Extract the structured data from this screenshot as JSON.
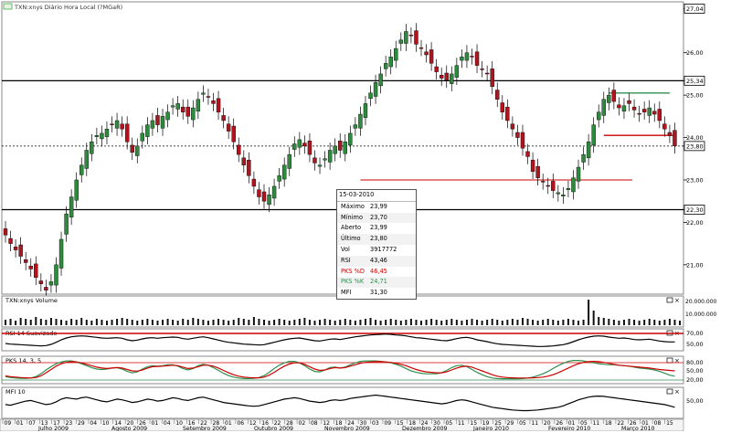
{
  "header": {
    "title": "TXN:xnys Diário Hora Local (?MGaR)"
  },
  "main_chart": {
    "price_labels": [
      "27,04",
      "26,00",
      "25,34",
      "25,00",
      "24,00",
      "23,80",
      "23,00",
      "22,30",
      "22,00",
      "21,00"
    ],
    "ylim": [
      20.35,
      27.2
    ]
  },
  "tooltip": {
    "date": "15-03-2010",
    "rows": [
      {
        "label": "Máximo",
        "value": "23,99",
        "color": "#000000"
      },
      {
        "label": "Mínimo",
        "value": "23,70",
        "color": "#000000"
      },
      {
        "label": "Aberto",
        "value": "23,99",
        "color": "#000000"
      },
      {
        "label": "Último",
        "value": "23,80",
        "color": "#000000"
      },
      {
        "label": "Vol",
        "value": "3917772",
        "color": "#000000"
      },
      {
        "label": "RSI",
        "value": "43,46",
        "color": "#000000"
      },
      {
        "label": "PKS %D",
        "value": "46,45",
        "color": "#cc0000"
      },
      {
        "label": "PKS %K",
        "value": "24,71",
        "color": "#2f8f4f"
      },
      {
        "label": "MFI",
        "value": "31,30",
        "color": "#000000"
      }
    ]
  },
  "panels": {
    "volume": {
      "title": "TXN:xnys Volume",
      "labels": [
        "20.000.000",
        "10.000.000"
      ]
    },
    "rsi": {
      "title": "RSI 14 Suavizado",
      "labels": [
        "70,00",
        "50,00"
      ]
    },
    "pks": {
      "title": "PKS 14, 3, 5",
      "labels": [
        "80,00",
        "50,00",
        "20,00"
      ]
    },
    "mfi": {
      "title": "MFI 10",
      "labels": [
        "50,00"
      ]
    }
  },
  "time_axis": {
    "day_ticks": [
      "09",
      "01",
      "07",
      "13",
      "17",
      "23",
      "29",
      "04",
      "10",
      "14",
      "20",
      "26",
      "01",
      "04",
      "10",
      "16",
      "22",
      "28",
      "01",
      "06",
      "12",
      "16",
      "22",
      "28",
      "02",
      "08",
      "12",
      "18",
      "24",
      "30",
      "03",
      "09",
      "15",
      "18",
      "24",
      "30",
      "05",
      "11",
      "15",
      "19",
      "25",
      "29",
      "05",
      "11",
      "20",
      "26",
      "01",
      "05",
      "11",
      "18",
      "22",
      "26",
      "01",
      "08",
      "15"
    ],
    "month_labels": [
      "Julho 2009",
      "Agosto 2009",
      "Setembro 2009",
      "Outubro 2009",
      "Novembro 2009",
      "Dezembro 2009",
      "Janeiro 2010",
      "Fevereiro 2010",
      "Março 2010"
    ]
  },
  "colors": {
    "up": "#2e8b3e",
    "down": "#b0141e",
    "line_red": "#cc0000",
    "line_green": "#2f8f4f"
  },
  "chart_data": {
    "type": "candlestick",
    "x_start": "2009-06-29",
    "close": [
      21.7,
      21.5,
      21.35,
      21.2,
      21.05,
      20.9,
      20.7,
      20.55,
      20.4,
      20.6,
      21.0,
      21.6,
      22.2,
      22.6,
      23.0,
      23.35,
      23.7,
      23.9,
      24.05,
      24.1,
      24.2,
      24.3,
      24.4,
      24.2,
      23.9,
      23.65,
      23.8,
      24.1,
      24.3,
      24.4,
      24.3,
      24.5,
      24.6,
      24.75,
      24.8,
      24.6,
      24.5,
      24.7,
      24.9,
      25.05,
      24.95,
      24.8,
      24.6,
      24.4,
      24.15,
      23.9,
      23.6,
      23.35,
      23.1,
      22.85,
      22.6,
      22.5,
      22.65,
      22.85,
      23.1,
      23.35,
      23.6,
      23.85,
      23.95,
      23.8,
      23.6,
      23.4,
      23.35,
      23.5,
      23.7,
      23.8,
      23.7,
      23.9,
      24.1,
      24.3,
      24.55,
      24.8,
      25.05,
      25.3,
      25.5,
      25.75,
      25.9,
      26.1,
      26.3,
      26.5,
      26.4,
      26.2,
      26.1,
      25.95,
      25.75,
      25.55,
      25.4,
      25.35,
      25.5,
      25.7,
      25.9,
      26.0,
      25.9,
      25.7,
      25.6,
      25.5,
      25.2,
      24.9,
      24.6,
      24.4,
      24.2,
      24.0,
      23.75,
      23.55,
      23.2,
      23.05,
      22.95,
      22.85,
      22.75,
      22.7,
      22.65,
      22.8,
      23.05,
      23.3,
      23.6,
      23.9,
      24.3,
      24.6,
      24.9,
      25.0,
      24.85,
      24.7,
      24.75,
      24.8,
      24.65,
      24.55,
      24.6,
      24.7,
      24.55,
      24.4,
      24.2,
      24.05,
      23.8
    ],
    "ylim": [
      20.35,
      27.2
    ],
    "horizontal_levels": [
      25.34,
      23.8,
      22.3
    ],
    "volume": [
      6,
      7,
      5,
      8,
      7,
      6,
      9,
      7,
      6,
      8,
      7,
      6,
      5,
      7,
      6,
      8,
      6,
      5,
      7,
      6,
      5,
      6,
      7,
      8,
      7,
      6,
      5,
      6,
      7,
      6,
      5,
      6,
      7,
      6,
      5,
      7,
      6,
      8,
      7,
      6,
      5,
      6,
      7,
      6,
      5,
      6,
      8,
      7,
      6,
      9,
      7,
      6,
      5,
      6,
      7,
      6,
      5,
      6,
      7,
      8,
      6,
      5,
      6,
      7,
      6,
      5,
      6,
      7,
      6,
      5,
      6,
      7,
      8,
      6,
      5,
      6,
      7,
      6,
      5,
      6,
      7,
      6,
      5,
      6,
      7,
      6,
      5,
      6,
      7,
      6,
      5,
      6,
      7,
      6,
      5,
      6,
      7,
      6,
      5,
      6,
      7,
      6,
      8,
      7,
      6,
      5,
      6,
      7,
      6,
      5,
      6,
      7,
      6,
      5,
      6,
      28,
      16,
      9,
      8,
      7,
      6,
      5,
      6,
      7,
      6,
      5,
      6,
      7,
      6,
      5,
      6,
      7,
      6,
      5
    ],
    "rsi": [
      38,
      36,
      35,
      34,
      33,
      32,
      31,
      30,
      31,
      35,
      42,
      50,
      56,
      60,
      62,
      63,
      62,
      60,
      58,
      56,
      55,
      56,
      57,
      55,
      50,
      47,
      49,
      53,
      56,
      57,
      55,
      57,
      58,
      59,
      58,
      54,
      52,
      55,
      58,
      60,
      57,
      53,
      49,
      45,
      42,
      40,
      38,
      36,
      35,
      34,
      33,
      34,
      38,
      42,
      46,
      50,
      53,
      55,
      56,
      53,
      50,
      47,
      46,
      49,
      52,
      53,
      51,
      54,
      57,
      60,
      62,
      64,
      66,
      67,
      68,
      69,
      68,
      66,
      65,
      63,
      60,
      57,
      56,
      54,
      52,
      50,
      48,
      47,
      50,
      54,
      57,
      58,
      55,
      50,
      47,
      44,
      40,
      37,
      35,
      34,
      33,
      32,
      31,
      30,
      29,
      28,
      28,
      29,
      30,
      32,
      34,
      38,
      44,
      50,
      55,
      59,
      62,
      63,
      62,
      59,
      57,
      55,
      56,
      54,
      51,
      50,
      51,
      52,
      49,
      46,
      44,
      43,
      43
    ],
    "pks_d": [
      25,
      22,
      20,
      18,
      17,
      16,
      18,
      25,
      38,
      52,
      66,
      76,
      82,
      85,
      84,
      80,
      74,
      68,
      62,
      58,
      56,
      58,
      60,
      58,
      52,
      46,
      45,
      50,
      58,
      64,
      65,
      66,
      68,
      70,
      68,
      62,
      56,
      58,
      64,
      70,
      70,
      66,
      58,
      48,
      38,
      30,
      24,
      20,
      18,
      17,
      17,
      20,
      28,
      40,
      54,
      66,
      75,
      80,
      80,
      74,
      64,
      54,
      48,
      50,
      56,
      60,
      58,
      60,
      66,
      72,
      78,
      82,
      84,
      85,
      85,
      84,
      82,
      78,
      74,
      68,
      60,
      52,
      46,
      42,
      40,
      38,
      38,
      42,
      50,
      58,
      64,
      66,
      62,
      54,
      46,
      38,
      30,
      24,
      20,
      18,
      17,
      16,
      16,
      16,
      17,
      18,
      20,
      24,
      30,
      38,
      48,
      58,
      68,
      76,
      82,
      85,
      86,
      85,
      82,
      78,
      74,
      70,
      68,
      66,
      64,
      62,
      60,
      58,
      55,
      52,
      50,
      48,
      46
    ],
    "pks_k": [
      22,
      18,
      16,
      15,
      15,
      16,
      22,
      34,
      50,
      64,
      76,
      84,
      88,
      88,
      84,
      76,
      68,
      60,
      54,
      52,
      54,
      58,
      60,
      54,
      44,
      38,
      42,
      54,
      64,
      68,
      66,
      68,
      72,
      72,
      66,
      56,
      50,
      56,
      68,
      74,
      70,
      60,
      48,
      36,
      26,
      20,
      16,
      14,
      14,
      15,
      18,
      26,
      40,
      56,
      70,
      80,
      86,
      86,
      80,
      68,
      54,
      44,
      42,
      50,
      60,
      62,
      58,
      62,
      72,
      80,
      86,
      88,
      88,
      88,
      86,
      84,
      80,
      74,
      66,
      56,
      46,
      40,
      36,
      34,
      34,
      34,
      38,
      48,
      60,
      68,
      70,
      64,
      52,
      40,
      30,
      22,
      16,
      14,
      13,
      13,
      13,
      13,
      14,
      16,
      20,
      26,
      34,
      44,
      56,
      68,
      78,
      86,
      90,
      90,
      88,
      84,
      80,
      76,
      74,
      72,
      72,
      70,
      68,
      66,
      62,
      58,
      56,
      54,
      50,
      44,
      36,
      28,
      24
    ],
    "mfi": [
      40,
      38,
      42,
      46,
      50,
      52,
      48,
      44,
      40,
      42,
      48,
      56,
      60,
      58,
      56,
      60,
      62,
      58,
      54,
      50,
      48,
      52,
      56,
      54,
      50,
      46,
      48,
      52,
      56,
      54,
      50,
      52,
      56,
      60,
      58,
      54,
      52,
      56,
      60,
      62,
      58,
      54,
      50,
      46,
      44,
      42,
      40,
      38,
      36,
      35,
      36,
      40,
      44,
      48,
      52,
      56,
      58,
      60,
      58,
      54,
      50,
      48,
      46,
      48,
      52,
      54,
      52,
      54,
      58,
      60,
      62,
      64,
      66,
      68,
      66,
      64,
      62,
      60,
      58,
      56,
      54,
      52,
      50,
      48,
      46,
      44,
      42,
      44,
      48,
      52,
      54,
      52,
      48,
      44,
      40,
      36,
      32,
      30,
      28,
      26,
      24,
      23,
      22,
      22,
      23,
      24,
      26,
      28,
      30,
      32,
      36,
      42,
      48,
      54,
      58,
      62,
      64,
      65,
      64,
      62,
      60,
      58,
      56,
      54,
      52,
      50,
      48,
      46,
      44,
      42,
      40,
      36,
      32
    ]
  }
}
